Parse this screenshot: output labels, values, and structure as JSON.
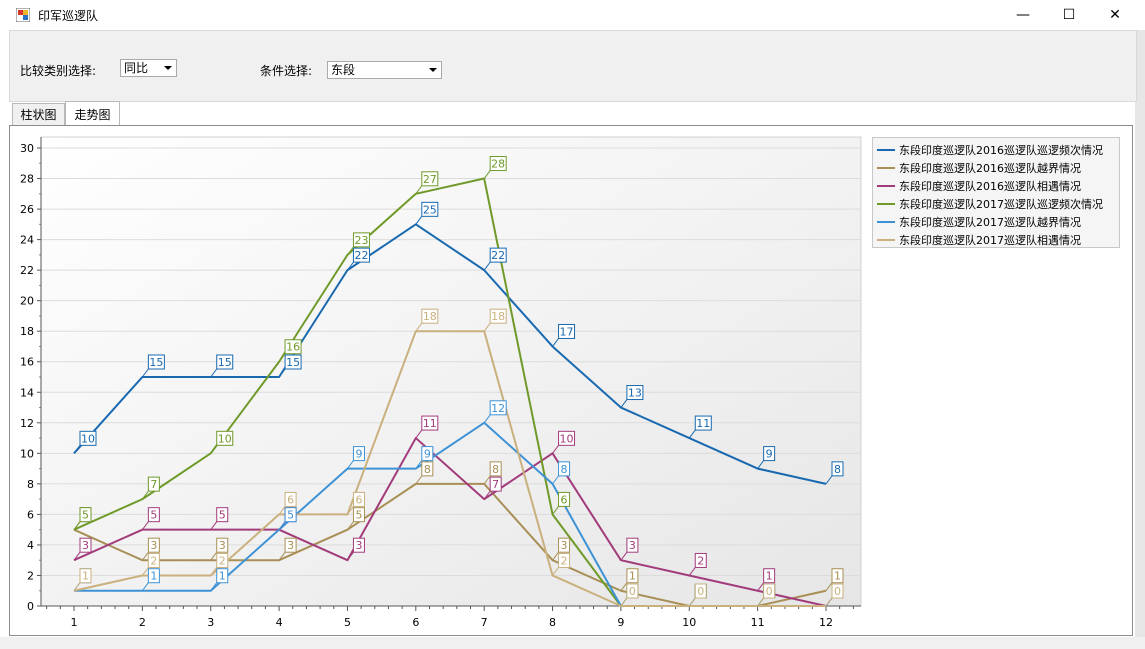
{
  "window": {
    "title": "印军巡逻队"
  },
  "toolbar": {
    "compare_label": "比较类别选择:",
    "compare_value": "同比",
    "condition_label": "条件选择:",
    "condition_value": "东段"
  },
  "tabs": [
    {
      "label": "柱状图"
    },
    {
      "label": "走势图"
    }
  ],
  "colors": [
    "#1869b0",
    "#a88f55",
    "#a23b7c",
    "#6f9a2a",
    "#3d92d6",
    "#c9b07d"
  ],
  "chart_data": {
    "type": "line",
    "x": [
      1,
      2,
      3,
      4,
      5,
      6,
      7,
      8,
      9,
      10,
      11,
      12
    ],
    "ylim": [
      0,
      30
    ],
    "yticks": [
      0,
      2,
      4,
      6,
      8,
      10,
      12,
      14,
      16,
      18,
      20,
      22,
      24,
      26,
      28,
      30
    ],
    "legend_position": "right",
    "grid": true,
    "series": [
      {
        "name": "东段印度巡逻队2016巡逻队巡逻频次情况",
        "values": [
          10,
          15,
          15,
          15,
          22,
          25,
          22,
          17,
          13,
          11,
          9,
          8
        ]
      },
      {
        "name": "东段印度巡逻队2016巡逻队越界情况",
        "values": [
          5,
          3,
          3,
          3,
          5,
          8,
          8,
          3,
          1,
          0,
          0,
          1
        ]
      },
      {
        "name": "东段印度巡逻队2016巡逻队相遇情况",
        "values": [
          3,
          5,
          5,
          5,
          3,
          11,
          7,
          10,
          3,
          2,
          1,
          0
        ]
      },
      {
        "name": "东段印度巡逻队2017巡逻队巡逻频次情况",
        "values": [
          5,
          7,
          10,
          16,
          23,
          27,
          28,
          6,
          0,
          0,
          0,
          0
        ]
      },
      {
        "name": "东段印度巡逻队2017巡逻队越界情况",
        "values": [
          1,
          1,
          1,
          5,
          9,
          9,
          12,
          8,
          0,
          0,
          0,
          0
        ]
      },
      {
        "name": "东段印度巡逻队2017巡逻队相遇情况",
        "values": [
          1,
          2,
          2,
          6,
          6,
          18,
          18,
          2,
          0,
          0,
          0,
          0
        ]
      }
    ]
  }
}
